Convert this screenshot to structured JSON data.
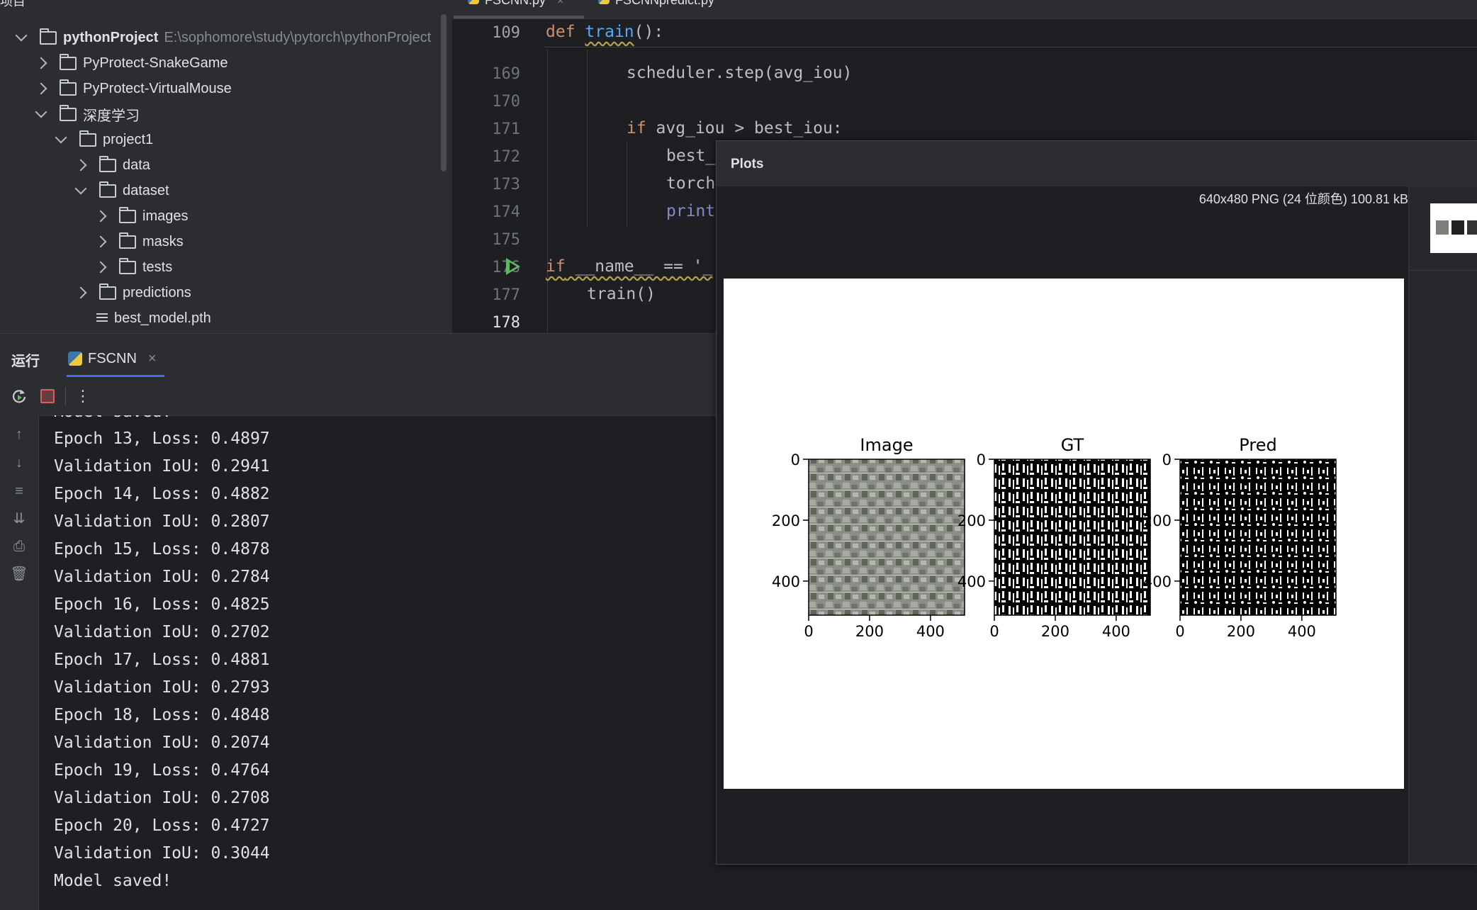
{
  "project_panel": {
    "header_label": "项目",
    "root": {
      "name": "pythonProject",
      "path": "E:\\sophomore\\study\\pytorch\\pythonProject"
    },
    "items": [
      {
        "label": "PyProtect-SnakeGame",
        "kind": "folder",
        "expanded": false
      },
      {
        "label": "PyProtect-VirtualMouse",
        "kind": "folder",
        "expanded": false
      },
      {
        "label": "深度学习",
        "kind": "folder",
        "expanded": true
      },
      {
        "label": "project1",
        "kind": "folder",
        "expanded": true
      },
      {
        "label": "data",
        "kind": "folder",
        "expanded": false
      },
      {
        "label": "dataset",
        "kind": "folder",
        "expanded": true
      },
      {
        "label": "images",
        "kind": "folder",
        "expanded": false
      },
      {
        "label": "masks",
        "kind": "folder",
        "expanded": false
      },
      {
        "label": "tests",
        "kind": "folder",
        "expanded": false
      },
      {
        "label": "predictions",
        "kind": "folder",
        "expanded": false
      },
      {
        "label": "best_model.pth",
        "kind": "file"
      }
    ]
  },
  "editor": {
    "tabs": [
      "FSCNN.py",
      "FSCNNpredict.py"
    ],
    "sticky": {
      "line": "109",
      "keyword": "def",
      "name": "train",
      "rest": "():"
    },
    "lines": [
      {
        "no": "169",
        "text": "scheduler.step(avg_iou)"
      },
      {
        "no": "170",
        "text": ""
      },
      {
        "no": "171",
        "kw": "if",
        "text": " avg_iou > best_iou:"
      },
      {
        "no": "172",
        "text": "best_"
      },
      {
        "no": "173",
        "text": "torch"
      },
      {
        "no": "174",
        "text": "print"
      },
      {
        "no": "175",
        "text": ""
      },
      {
        "no": "176",
        "kw": "if",
        "text": " __name__ == '_"
      },
      {
        "no": "177",
        "text": "train()"
      },
      {
        "no": "178",
        "text": ""
      }
    ]
  },
  "run_panel": {
    "label": "运行",
    "tab": "FSCNN",
    "console_partial": "Model saved!",
    "console": [
      "Epoch 13, Loss: 0.4897",
      "Validation IoU: 0.2941",
      "Epoch 14, Loss: 0.4882",
      "Validation IoU: 0.2807",
      "Epoch 15, Loss: 0.4878",
      "Validation IoU: 0.2784",
      "Epoch 16, Loss: 0.4825",
      "Validation IoU: 0.2702",
      "Epoch 17, Loss: 0.4881",
      "Validation IoU: 0.2793",
      "Epoch 18, Loss: 0.4848",
      "Validation IoU: 0.2074",
      "Epoch 19, Loss: 0.4764",
      "Validation IoU: 0.2708",
      "Epoch 20, Loss: 0.4727",
      "Validation IoU: 0.3044",
      "Model saved!"
    ],
    "side_icons": [
      "arrow-up-icon",
      "arrow-down-icon",
      "soft-wrap-icon",
      "scroll-to-end-icon",
      "print-icon",
      "trash-icon"
    ],
    "toolbar_icons": [
      "rerun-icon",
      "stop-icon",
      "more-icon"
    ]
  },
  "plots": {
    "title": "Plots",
    "image_info": "640x480 PNG (24 位颜色) 100.81 kB",
    "panels": [
      {
        "title": "Image",
        "kind": "photo"
      },
      {
        "title": "GT",
        "kind": "mask"
      },
      {
        "title": "Pred",
        "kind": "mask"
      }
    ],
    "x_ticks": [
      "0",
      "200",
      "400"
    ],
    "y_ticks": [
      "0",
      "200",
      "400"
    ]
  },
  "colors": {
    "run_icon": "#5fb865",
    "stop_icon": "#db5c5c",
    "tab_accent": "#3574f0"
  }
}
